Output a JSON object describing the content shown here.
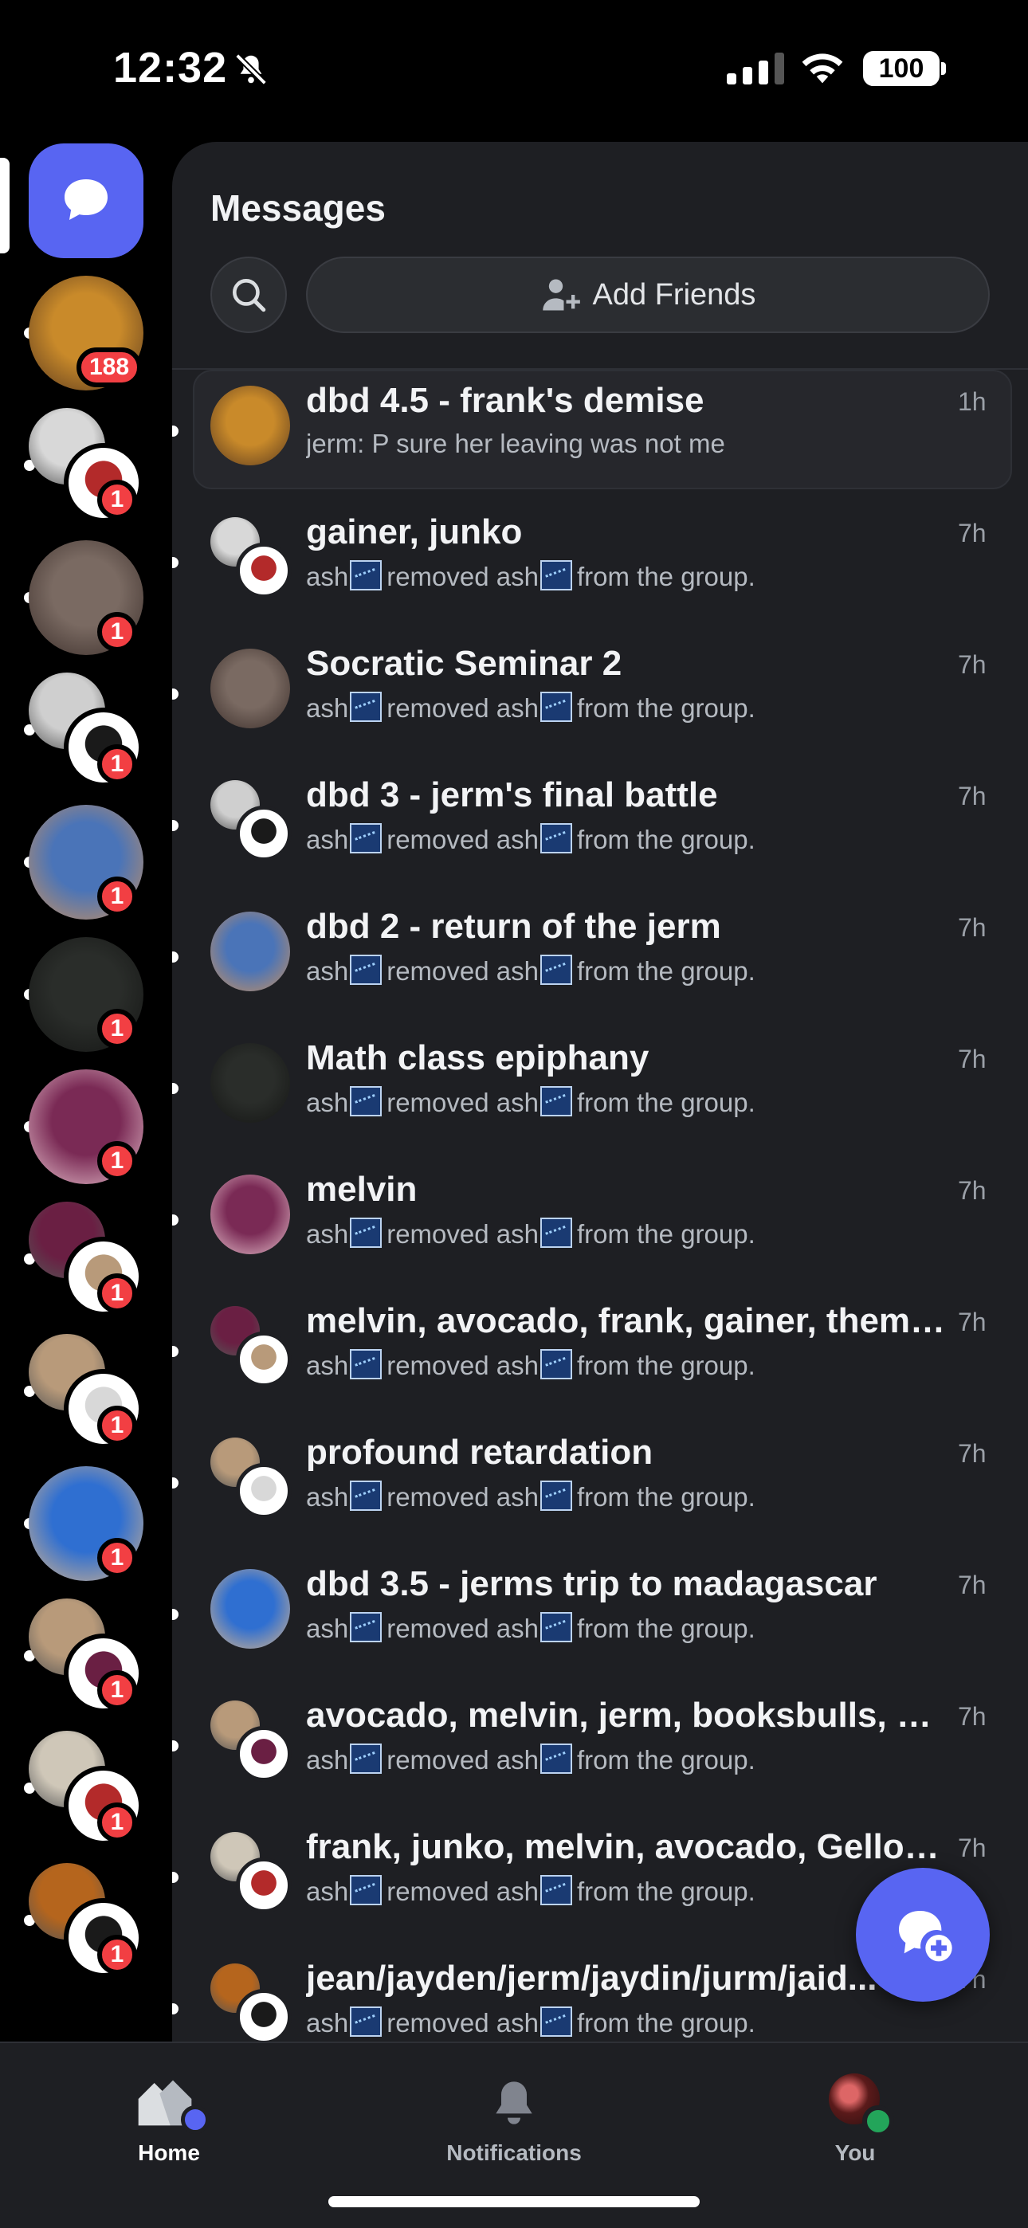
{
  "status_bar": {
    "time": "12:32",
    "battery": "100",
    "icons": [
      "bell-slash-icon",
      "cellular-signal-icon",
      "wifi-icon",
      "battery-icon"
    ]
  },
  "rail": {
    "dm_icon": "chat-bubble-icon",
    "items": [
      {
        "badge": "188",
        "colors": [
          "#c98a2a",
          "#5a3a1f"
        ]
      },
      {
        "badge": "1",
        "colors": [
          "#d8d8d8",
          "#b32a2a"
        ]
      },
      {
        "badge": "1",
        "colors": [
          "#7a6a62",
          "#3b2e2a"
        ]
      },
      {
        "badge": "1",
        "colors": [
          "#cfcfcf",
          "#1a1a1a"
        ]
      },
      {
        "badge": "1",
        "colors": [
          "#4a74b8",
          "#c8905e"
        ]
      },
      {
        "badge": "1",
        "colors": [
          "#2a2d2a",
          "#141514"
        ]
      },
      {
        "badge": "1",
        "colors": [
          "#7a2a55",
          "#e6c1cc"
        ]
      },
      {
        "badge": "1",
        "colors": [
          "#6a1f43",
          "#b89a7a"
        ]
      },
      {
        "badge": "1",
        "colors": [
          "#b89a7a",
          "#d8d8d8"
        ]
      },
      {
        "badge": "1",
        "colors": [
          "#2f6fd1",
          "#d9b48a"
        ]
      },
      {
        "badge": "1",
        "colors": [
          "#b89a7a",
          "#6a1f43"
        ]
      },
      {
        "badge": "1",
        "colors": [
          "#cfc7b8",
          "#b32a2a"
        ]
      },
      {
        "badge": "1",
        "colors": [
          "#b5651d",
          "#1a1a1a"
        ]
      }
    ]
  },
  "panel": {
    "title": "Messages",
    "add_friends_label": "Add Friends",
    "search_icon": "search-icon",
    "add_friend_icon": "person-add-icon"
  },
  "conversations": [
    {
      "name": "dbd 4.5 - frank's demise",
      "preview": "jerm: P sure her leaving was not me",
      "time": "1h",
      "colors": [
        "#c98a2a",
        "#5a3a1f"
      ],
      "group": false,
      "highlight": true,
      "emote_preview": false
    },
    {
      "name": "gainer, junko",
      "preview_parts": [
        "ash",
        "removed ash",
        "from the group."
      ],
      "time": "7h",
      "colors": [
        "#d8d8d8",
        "#b32a2a"
      ],
      "group": true
    },
    {
      "name": "Socratic Seminar 2",
      "preview_parts": [
        "ash",
        "removed ash",
        "from the group."
      ],
      "time": "7h",
      "colors": [
        "#7a6a62",
        "#3b2e2a"
      ],
      "group": false
    },
    {
      "name": "dbd 3 - jerm's final battle",
      "preview_parts": [
        "ash",
        "removed ash",
        "from the group."
      ],
      "time": "7h",
      "colors": [
        "#cfcfcf",
        "#1a1a1a"
      ],
      "group": true
    },
    {
      "name": "dbd 2 - return of the jerm",
      "preview_parts": [
        "ash",
        "removed ash",
        "from the group."
      ],
      "time": "7h",
      "colors": [
        "#4a74b8",
        "#c8905e"
      ],
      "group": false
    },
    {
      "name": "Math class epiphany",
      "preview_parts": [
        "ash",
        "removed ash",
        "from the group."
      ],
      "time": "7h",
      "colors": [
        "#2a2d2a",
        "#141514"
      ],
      "group": false
    },
    {
      "name": "melvin",
      "preview_parts": [
        "ash",
        "removed ash",
        "from the group."
      ],
      "time": "7h",
      "colors": [
        "#7a2a55",
        "#e6c1cc"
      ],
      "group": false
    },
    {
      "name": "melvin, avocado, frank, gainer, themu,...",
      "preview_parts": [
        "ash",
        "removed ash",
        "from the group."
      ],
      "time": "7h",
      "colors": [
        "#6a1f43",
        "#b89a7a"
      ],
      "group": true
    },
    {
      "name": "profound retardation",
      "preview_parts": [
        "ash",
        "removed ash",
        "from the group."
      ],
      "time": "7h",
      "colors": [
        "#b89a7a",
        "#d8d8d8"
      ],
      "group": true
    },
    {
      "name": "dbd 3.5 - jerms trip to madagascar",
      "preview_parts": [
        "ash",
        "removed ash",
        "from the group."
      ],
      "time": "7h",
      "colors": [
        "#2f6fd1",
        "#d9b48a"
      ],
      "group": false
    },
    {
      "name": "avocado, melvin, jerm, booksbulls, mig...",
      "preview_parts": [
        "ash",
        "removed ash",
        "from the group."
      ],
      "time": "7h",
      "colors": [
        "#b89a7a",
        "#6a1f43"
      ],
      "group": true
    },
    {
      "name": "frank, junko, melvin, avocado, GelloMel...",
      "preview_parts": [
        "ash",
        "removed ash",
        "from the group."
      ],
      "time": "7h",
      "colors": [
        "#cfc7b8",
        "#b32a2a"
      ],
      "group": true
    },
    {
      "name": "jean/jayden/jerm/jaydin/jurm/jaid...",
      "preview_parts": [
        "ash",
        "removed ash",
        "from the group."
      ],
      "time": "7h",
      "colors": [
        "#b5651d",
        "#1a1a1a"
      ],
      "group": true
    }
  ],
  "fab_icon": "new-message-icon",
  "tabs": [
    {
      "label": "Home",
      "icon": "home-icon",
      "active": true
    },
    {
      "label": "Notifications",
      "icon": "bell-icon",
      "active": false
    },
    {
      "label": "You",
      "icon": "avatar",
      "active": false
    }
  ],
  "accent": "#5865f2",
  "badge_color": "#f23f43"
}
